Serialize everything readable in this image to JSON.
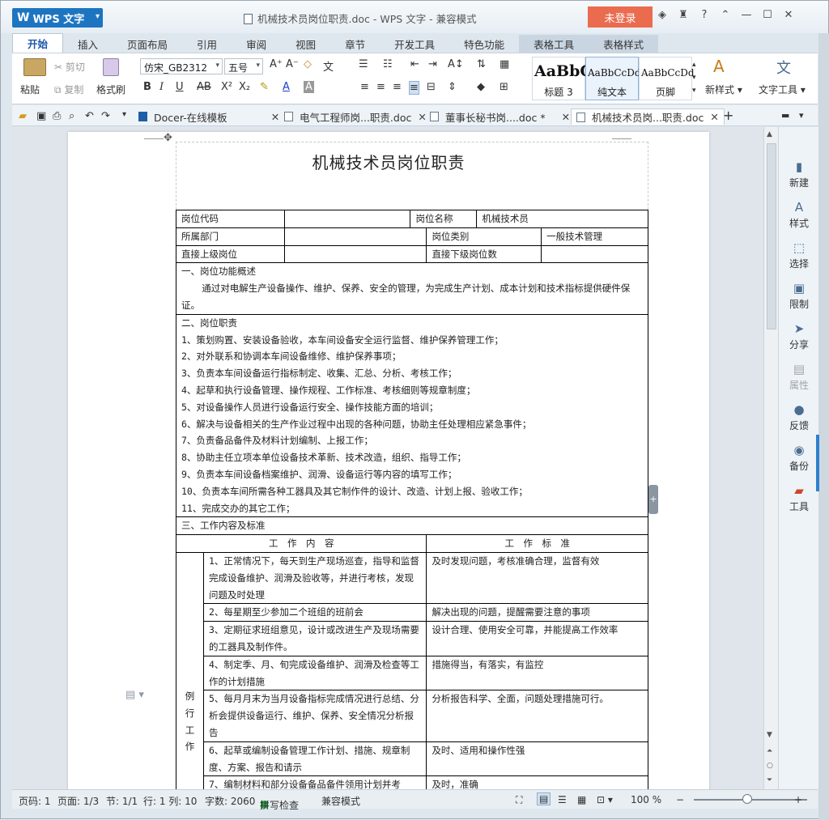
{
  "app": {
    "logo": "WPS 文字",
    "title": "机械技术员岗位职责.doc - WPS 文字 - 兼容模式",
    "login": "未登录"
  },
  "tabs": [
    "开始",
    "插入",
    "页面布局",
    "引用",
    "审阅",
    "视图",
    "章节",
    "开发工具",
    "特色功能",
    "表格工具",
    "表格样式"
  ],
  "ribbon": {
    "paste": "粘贴",
    "cut": "剪切",
    "copy": "复制",
    "format_painter": "格式刷",
    "font_name": "仿宋_GB2312",
    "font_size": "五号",
    "styles": [
      {
        "sample": "AaBbC",
        "label": "标题 3"
      },
      {
        "sample": "AaBbCcDd",
        "label": "纯文本"
      },
      {
        "sample": "AaBbCcDd",
        "label": "页脚"
      }
    ],
    "new_style": "新样式",
    "text_tools": "文字工具"
  },
  "doctabs": [
    {
      "label": "Docer-在线模板"
    },
    {
      "label": "电气工程师岗...职责.doc"
    },
    {
      "label": "董事长秘书岗....doc *"
    },
    {
      "label": "机械技术员岗...职责.doc"
    }
  ],
  "doc": {
    "title": "机械技术员岗位职责",
    "row1": {
      "c1": "岗位代码",
      "c2": "",
      "c3": "岗位名称",
      "c4": "机械技术员"
    },
    "row2": {
      "c1": "所属部门",
      "c2": "",
      "c3": "岗位类别",
      "c4": "一般技术管理"
    },
    "row3": {
      "c1": "直接上级岗位",
      "c2": "",
      "c3": "直接下级岗位数",
      "c4": ""
    },
    "sec1_title": "一、岗位功能概述",
    "sec1_body": "通过对电解生产设备操作、维护、保养、安全的管理，为完成生产计划、成本计划和技术指标提供硬件保证。",
    "sec2_title": "二、岗位职责",
    "duties": [
      "1、策划购置、安装设备验收，本车间设备安全运行监督、维护保养管理工作；",
      "2、对外联系和协调本车间设备维修、维护保养事项；",
      "3、负责本车间设备运行指标制定、收集、汇总、分析、考核工作；",
      "4、起草和执行设备管理、操作规程、工作标准、考核细则等规章制度；",
      "5、对设备操作人员进行设备运行安全、操作技能方面的培训；",
      "6、解决与设备相关的生产作业过程中出现的各种问题，协助主任处理相应紧急事件；",
      "7、负责备品备件及材料计划编制、上报工作；",
      "8、协助主任立项本单位设备技术革新、技术改造，组织、指导工作；",
      "9、负责本车间设备档案维护、润滑、设备运行等内容的填写工作；",
      "10、负责本车间所需各种工器具及其它制作件的设计、改造、计划上报、验收工作；",
      "11、完成交办的其它工作；"
    ],
    "sec3_title": "三、工作内容及标准",
    "col_content": "工　作　内　容",
    "col_standard": "工　作　标　准",
    "routine_label": "例行工作",
    "work": [
      {
        "content": "1、正常情况下，每天到生产现场巡查，指导和监督完成设备维护、润滑及验收等，并进行考核，发现问题及时处理",
        "standard": "及时发现问题，考核准确合理，监督有效"
      },
      {
        "content": "2、每星期至少参加二个班组的班前会",
        "standard": "解决出现的问题，提醒需要注意的事项"
      },
      {
        "content": "3、定期征求班组意见，设计或改进生产及现场需要的工器具及制作件。",
        "standard": "设计合理、使用安全可靠，并能提高工作效率"
      },
      {
        "content": "4、制定季、月、旬完成设备维护、润滑及检查等工作的计划措施",
        "standard": "措施得当，有落实，有监控"
      },
      {
        "content": "5、每月月末为当月设备指标完成情况进行总结、分析会提供设备运行、维护、保养、安全情况分析报告",
        "standard": "分析报告科学、全面，问题处理措施可行。"
      },
      {
        "content": "6、起草或编制设备管理工作计划、措施、规章制度、方案、报告和请示",
        "standard": "及时、适用和操作性强"
      },
      {
        "content": "7、编制材料和部分设备备品备件领用计划并考",
        "standard": "及时，准确"
      }
    ]
  },
  "rightpanel": [
    "新建",
    "样式",
    "选择",
    "限制",
    "分享",
    "属性",
    "反馈",
    "备份",
    "工具"
  ],
  "status": {
    "page": "页码: 1",
    "pages": "页面: 1/3",
    "section": "节: 1/1",
    "rowcol": "行: 1  列: 10",
    "words": "字数: 2060",
    "spell": "拼写检查",
    "mode": "兼容模式",
    "zoom": "100 %"
  }
}
